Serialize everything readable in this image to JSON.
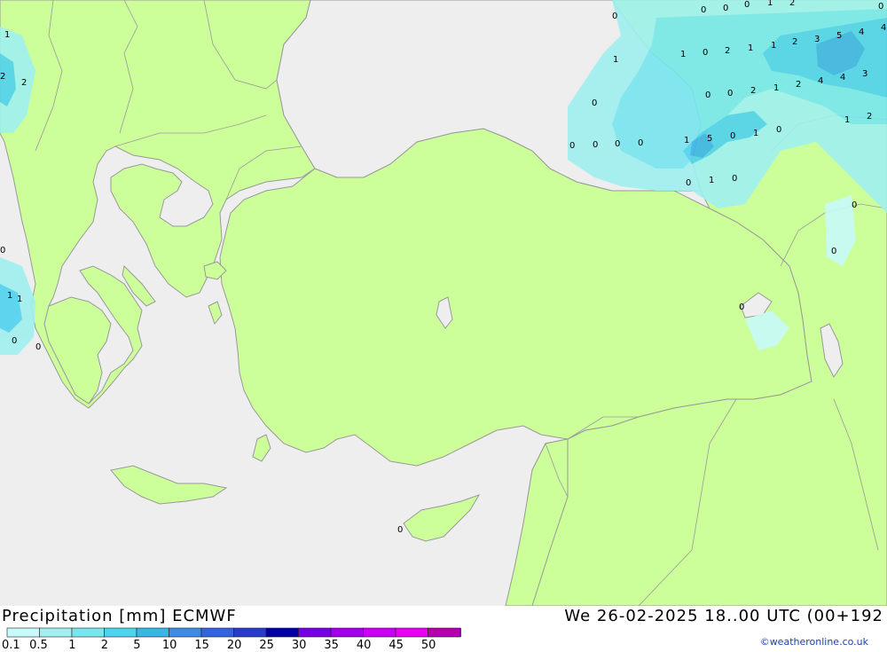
{
  "map": {
    "colors": {
      "sea": "#eeeeee",
      "land": "#ccff99",
      "border": "#999999"
    },
    "value_labels": [
      "0",
      "0",
      "0",
      "1",
      "2",
      "1",
      "0",
      "2",
      "1",
      "1",
      "2",
      "3",
      "5",
      "4",
      "4",
      "1",
      "0",
      "0",
      "0",
      "2",
      "1",
      "2",
      "4",
      "4",
      "3",
      "1",
      "2",
      "0",
      "0",
      "0",
      "0",
      "1",
      "5",
      "0",
      "1",
      "0",
      "0",
      "1",
      "0",
      "0",
      "0",
      "1",
      "1",
      "0",
      "0",
      "0",
      "2",
      "2",
      "1",
      "0",
      "0",
      "0",
      "0"
    ]
  },
  "footer": {
    "title": "Precipitation [mm] ECMWF",
    "datetime": "We 26-02-2025 18..00 UTC (00+192",
    "credit": "©weatheronline.co.uk"
  },
  "legend": {
    "ticks": [
      "0.1",
      "0.5",
      "1",
      "2",
      "5",
      "10",
      "15",
      "20",
      "25",
      "30",
      "35",
      "40",
      "45",
      "50"
    ],
    "colors": [
      "#c8fafa",
      "#a0f0f0",
      "#78e6ee",
      "#50d2ee",
      "#3cb4e6",
      "#3c8ce6",
      "#3264dc",
      "#283cc8",
      "#0000a0",
      "#7800dc",
      "#a000e6",
      "#c800f0",
      "#e600f0",
      "#b000b0"
    ]
  }
}
